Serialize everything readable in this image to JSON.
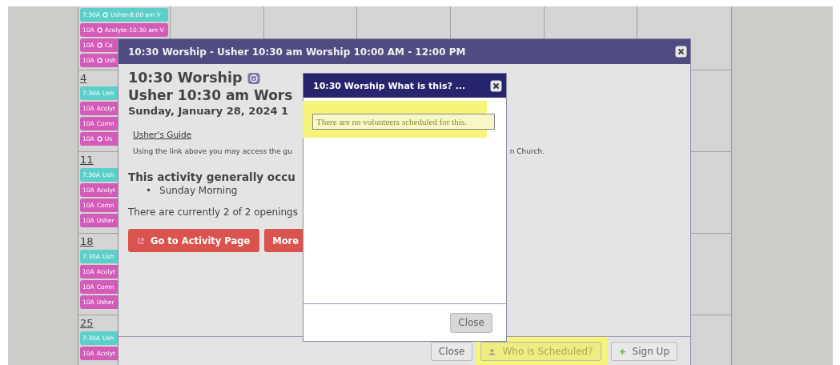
{
  "calendar": {
    "weeks": [
      {
        "events": [
          {
            "time": "7:30A",
            "marked": true,
            "text": "Usher-8:00 am V",
            "color": "#5ccfca"
          },
          {
            "time": "10A",
            "marked": true,
            "text": "Acolyte-10:30 am V",
            "color": "#d45cb9"
          },
          {
            "time": "10A",
            "marked": true,
            "text": "Co",
            "color": "#d45cb9"
          },
          {
            "time": "10A",
            "marked": true,
            "text": "Ush",
            "color": "#d45cb9"
          }
        ]
      },
      {
        "day": "4",
        "events": [
          {
            "time": "7:30A",
            "marked": false,
            "text": "Ush",
            "color": "#5ccfca"
          },
          {
            "time": "10A",
            "marked": false,
            "text": "Acolyt",
            "color": "#d45cb9"
          },
          {
            "time": "10A",
            "marked": false,
            "text": "Comn",
            "color": "#d45cb9"
          },
          {
            "time": "10A",
            "marked": true,
            "text": "Us",
            "color": "#d45cb9"
          }
        ]
      },
      {
        "day": "11",
        "events": [
          {
            "time": "7:30A",
            "marked": false,
            "text": "Ush",
            "color": "#5ccfca"
          },
          {
            "time": "10A",
            "marked": false,
            "text": "Acolyt",
            "color": "#d45cb9"
          },
          {
            "time": "10A",
            "marked": false,
            "text": "Comn",
            "color": "#d45cb9"
          },
          {
            "time": "10A",
            "marked": false,
            "text": "Usher",
            "color": "#d45cb9"
          }
        ]
      },
      {
        "day": "18",
        "events": [
          {
            "time": "7:30A",
            "marked": false,
            "text": "Ush",
            "color": "#5ccfca"
          },
          {
            "time": "10A",
            "marked": false,
            "text": "Acolyt",
            "color": "#d45cb9"
          },
          {
            "time": "10A",
            "marked": false,
            "text": "Comn",
            "color": "#d45cb9"
          },
          {
            "time": "10A",
            "marked": false,
            "text": "Usher",
            "color": "#d45cb9"
          }
        ]
      },
      {
        "day": "25",
        "events": [
          {
            "time": "7:30A",
            "marked": false,
            "text": "Ush",
            "color": "#5ccfca"
          },
          {
            "time": "10A",
            "marked": false,
            "text": "Acolyt",
            "color": "#d45cb9"
          }
        ]
      }
    ]
  },
  "modal": {
    "title": "10:30 Worship - Usher 10:30 am Worship 10:00 AM - 12:00 PM",
    "heading": "10:30 Worship",
    "subheading": "Usher 10:30 am Wors",
    "date": "Sunday, January 28, 2024 1",
    "link": "Usher's Guide",
    "description": "Using the link above you may access the gu",
    "description_end": "n Church.",
    "occurs_heading": "This activity generally occu",
    "occurs": [
      {
        "bullet": "•",
        "text": "Sunday Morning"
      }
    ],
    "openings": "There are currently 2 of 2 openings",
    "buttons": [
      {
        "label": "Go to Activity Page",
        "kind": "external"
      },
      {
        "label": "More",
        "kind": "plain"
      }
    ],
    "footer_buttons": [
      {
        "label": "Close",
        "kind": "plain",
        "highlighted": false
      },
      {
        "label": "Who is Scheduled?",
        "kind": "person",
        "highlighted": true
      },
      {
        "label": "Sign Up",
        "kind": "plus",
        "highlighted": false
      }
    ]
  },
  "dialog": {
    "title": "10:30 Worship What is this? ...",
    "message": "There are no volunteers scheduled for this.",
    "highlighted": true,
    "close": "Close"
  }
}
